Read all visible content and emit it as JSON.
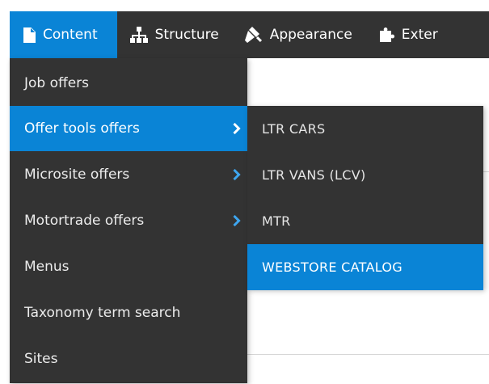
{
  "toolbar": {
    "tabs": [
      {
        "label": "Content"
      },
      {
        "label": "Structure"
      },
      {
        "label": "Appearance"
      },
      {
        "label": "Exter"
      }
    ]
  },
  "menu": {
    "items": [
      {
        "label": "Job offers"
      },
      {
        "label": "Offer tools offers"
      },
      {
        "label": "Microsite offers"
      },
      {
        "label": "Motortrade offers"
      },
      {
        "label": "Menus"
      },
      {
        "label": "Taxonomy term search"
      },
      {
        "label": "Sites"
      }
    ]
  },
  "submenu": {
    "items": [
      {
        "label": "LTR CARS"
      },
      {
        "label": "LTR VANS (LCV)"
      },
      {
        "label": "MTR"
      },
      {
        "label": "WEBSTORE CATALOG"
      }
    ]
  },
  "colors": {
    "bar": "#333333",
    "accent": "#0a84d6",
    "chevron": "#3ea6f0"
  }
}
